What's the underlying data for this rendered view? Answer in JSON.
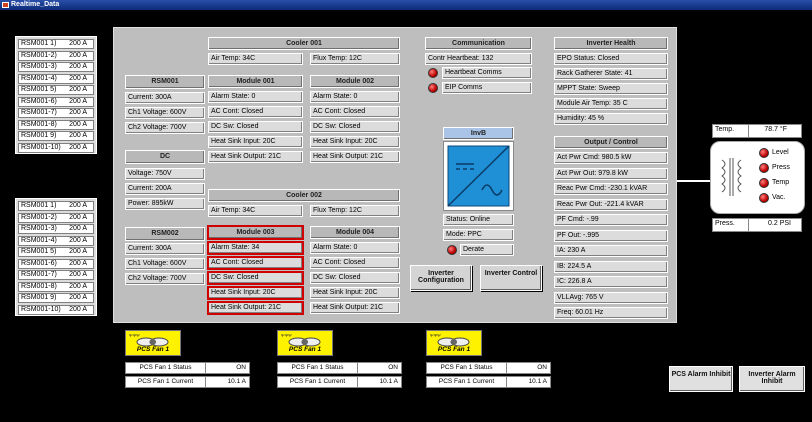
{
  "window": {
    "title": "Realtime_Data"
  },
  "rsm_groups": [
    {
      "rows": [
        [
          "RSM001 1)",
          "200 A"
        ],
        [
          "RSM001-2)",
          "200 A"
        ],
        [
          "RSM001-3)",
          "200 A"
        ],
        [
          "RSM001-4)",
          "200 A"
        ],
        [
          "RSM001 5)",
          "200 A"
        ],
        [
          "RSM001-6)",
          "200 A"
        ],
        [
          "RSM001-7)",
          "200 A"
        ],
        [
          "RSM001-8)",
          "200 A"
        ],
        [
          "RSM001 9)",
          "200 A"
        ],
        [
          "RSM001-10)",
          "200 A"
        ]
      ]
    },
    {
      "rows": [
        [
          "RSM001 1)",
          "200 A"
        ],
        [
          "RSM001-2)",
          "200 A"
        ],
        [
          "RSM001-3)",
          "200 A"
        ],
        [
          "RSM001-4)",
          "200 A"
        ],
        [
          "RSM001 5)",
          "200 A"
        ],
        [
          "RSM001-6)",
          "200 A"
        ],
        [
          "RSM001-7)",
          "200 A"
        ],
        [
          "RSM001-8)",
          "200 A"
        ],
        [
          "RSM001 9)",
          "200 A"
        ],
        [
          "RSM001-10)",
          "200 A"
        ]
      ]
    }
  ],
  "rsm001": {
    "title": "RSM001",
    "current": "Current: 300A",
    "ch1": "Ch1 Voltage: 600V",
    "ch2": "Ch2 Voltage: 700V"
  },
  "rsm002": {
    "title": "RSM002",
    "current": "Current: 300A",
    "ch1": "Ch1 Voltage: 600V",
    "ch2": "Ch2 Voltage: 700V"
  },
  "dc": {
    "title": "DC",
    "voltage": "Voltage: 750V",
    "current": "Current: 200A",
    "power": "Power: 895kW"
  },
  "cooler1": {
    "title": "Cooler 001",
    "air": "Air Temp: 34C",
    "flux": "Flux Temp: 12C"
  },
  "cooler2": {
    "title": "Cooler 002",
    "air": "Air Temp: 34C",
    "flux": "Flux Temp: 12C"
  },
  "module001": {
    "title": "Module 001",
    "rows": [
      "Alarm State: 0",
      "AC Cont: Closed",
      "DC Sw: Closed",
      "Heat Sink Input: 20C",
      "Heat Sink Output: 21C"
    ]
  },
  "module002": {
    "title": "Module 002",
    "rows": [
      "Alarm State: 0",
      "AC Cont: Closed",
      "DC Sw: Closed",
      "Heat Sink Input: 20C",
      "Heat Sink Output: 21C"
    ]
  },
  "module003": {
    "title": "Module 003",
    "rows": [
      "Alarm State: 34",
      "AC Cont: Closed",
      "DC Sw: Closed",
      "Heat Sink Input: 20C",
      "Heat Sink Output: 21C"
    ]
  },
  "module004": {
    "title": "Module 004",
    "rows": [
      "Alarm State: 0",
      "AC Cont: Closed",
      "DC Sw: Closed",
      "Heat Sink Input: 20C",
      "Heat Sink Output: 21C"
    ]
  },
  "comm": {
    "title": "Communication",
    "heartbeat": "Contr Heartbeat: 132",
    "hb_comms": "Heartbeat Comms",
    "eip": "EIP Comms"
  },
  "invb": {
    "title": "InvB",
    "status": "Status: Online",
    "mode": "Mode: PPC",
    "derate": "Derate"
  },
  "buttons": {
    "inv_config": "Inverter Configuration",
    "inv_control": "Inverter Control",
    "pcs_alarm": "PCS Alarm Inhibit",
    "inv_alarm": "Inverter Alarm Inhibit"
  },
  "health": {
    "title": "Inverter Health",
    "rows": [
      "EPO Status: Closed",
      "Rack Gatherer State: 41",
      "MPPT State: Sweep",
      "Module Air Temp: 35 C",
      "Humidity: 45 %"
    ]
  },
  "output": {
    "title": "Output / Control",
    "rows": [
      "Act Pwr Cmd: 980.5 kW",
      "Act Pwr Out: 979.8 kW",
      "Reac Pwr Cmd: -230.1 kVAR",
      "Reac Pwr Out: -221.4 kVAR",
      "PF Cmd: -.99",
      "PF Out: -.995",
      "IA: 230 A",
      "IB: 224.5 A",
      "IC: 226.8 A",
      "VLLAvg: 765 V",
      "Freq: 60.01 Hz"
    ]
  },
  "transformer": {
    "temp_label": "Temp.",
    "temp_value": "78.7 °F",
    "press_label": "Press.",
    "press_value": "0.2 PSI",
    "indicators": [
      "Level",
      "Press",
      "Temp",
      "Vac."
    ]
  },
  "fans": [
    {
      "label": "PCS Fan 1",
      "status_label": "PCS Fan 1 Status",
      "status": "ON",
      "current_label": "PCS Fan 1 Current",
      "current": "10.1 A"
    },
    {
      "label": "PCS Fan 1",
      "status_label": "PCS Fan 1 Status",
      "status": "ON",
      "current_label": "PCS Fan 1 Current",
      "current": "10.1 A"
    },
    {
      "label": "PCS Fan 1",
      "status_label": "PCS Fan 1 Status",
      "status": "ON",
      "current_label": "PCS Fan 1 Current",
      "current": "10.1 A"
    }
  ],
  "colors": {
    "alarm_outline": "#d00000",
    "fan_yellow": "#fff200",
    "inverter_blue": "#1f8fd6"
  }
}
